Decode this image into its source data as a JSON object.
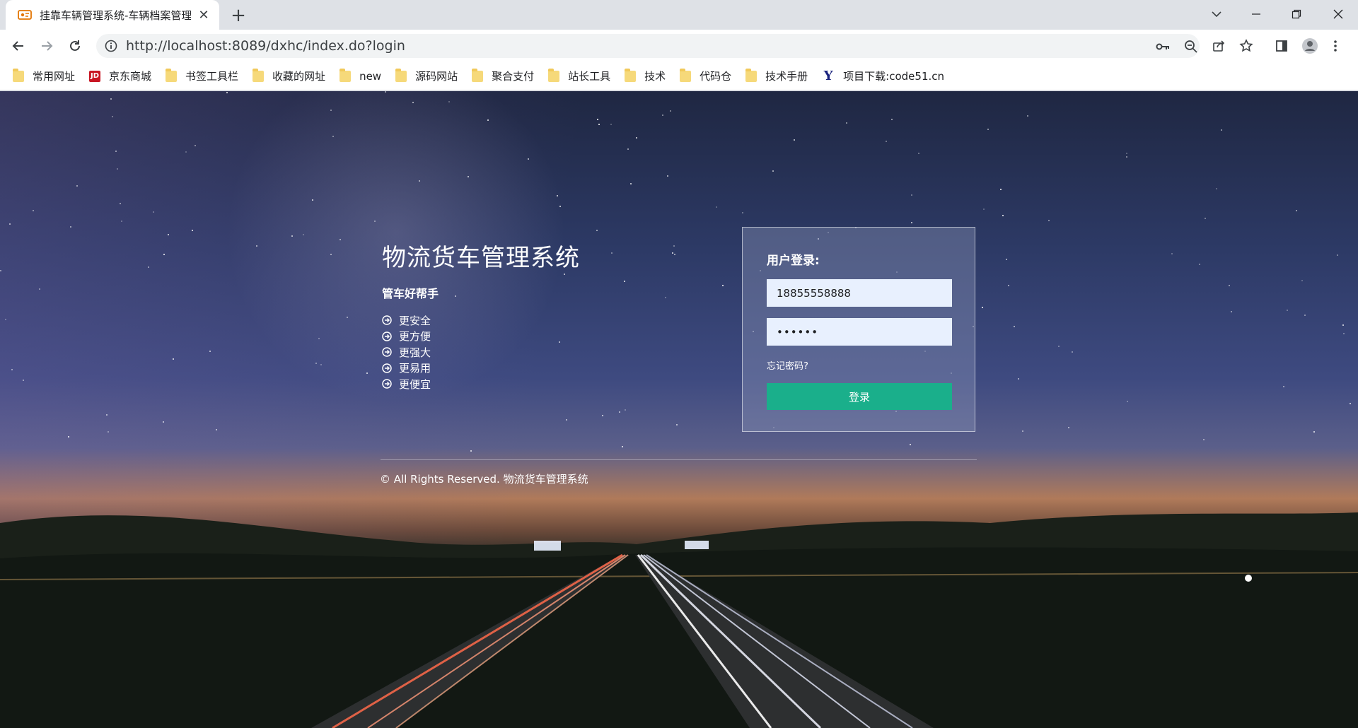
{
  "browser": {
    "tab_title": "挂靠车辆管理系统-车辆档案管理",
    "url": "http://localhost:8089/dxhc/index.do?login",
    "bookmarks": [
      {
        "label": "常用网址",
        "icon": "folder"
      },
      {
        "label": "京东商城",
        "icon": "jd-logo"
      },
      {
        "label": "书签工具栏",
        "icon": "folder"
      },
      {
        "label": "收藏的网址",
        "icon": "folder"
      },
      {
        "label": "new",
        "icon": "folder"
      },
      {
        "label": "源码网站",
        "icon": "folder"
      },
      {
        "label": "聚合支付",
        "icon": "folder"
      },
      {
        "label": "站长工具",
        "icon": "folder"
      },
      {
        "label": "技术",
        "icon": "folder"
      },
      {
        "label": "代码仓",
        "icon": "folder"
      },
      {
        "label": "技术手册",
        "icon": "folder"
      },
      {
        "label": "项目下载:code51.cn",
        "icon": "y-logo"
      }
    ]
  },
  "intro": {
    "title": "物流货车管理系统",
    "subtitle": "管车好帮手",
    "features": [
      "更安全",
      "更方便",
      "更强大",
      "更易用",
      "更便宜"
    ]
  },
  "login": {
    "title": "用户登录:",
    "username_value": "18855558888",
    "password_value": "123456",
    "forgot_link": "忘记密码?",
    "submit_label": "登录",
    "accent_color": "#1aaf8b"
  },
  "footer": {
    "copyright": "© All Rights Reserved. 物流货车管理系统"
  }
}
